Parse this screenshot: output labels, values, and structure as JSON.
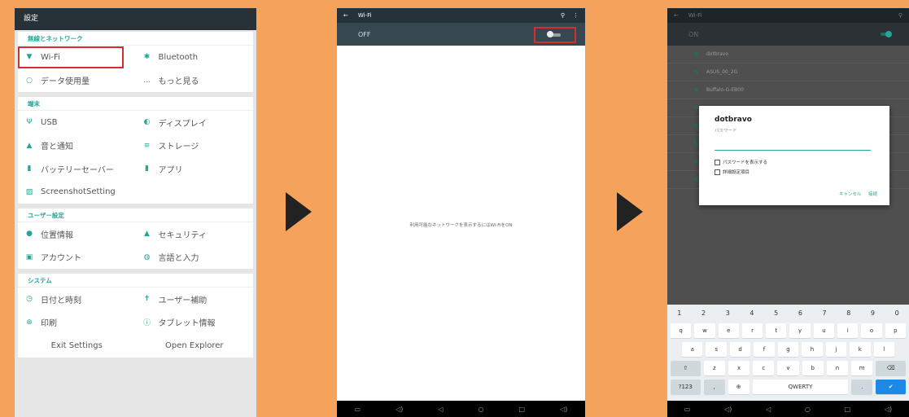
{
  "screen1": {
    "title": "設定",
    "sections": [
      {
        "title": "無線とネットワーク",
        "rows": [
          [
            {
              "icon": "▼",
              "label": "Wi-Fi"
            },
            {
              "icon": "✱",
              "label": "Bluetooth"
            }
          ],
          [
            {
              "icon": "○",
              "label": "データ使用量"
            },
            {
              "icon": "…",
              "label": "もっと見る"
            }
          ]
        ]
      },
      {
        "title": "端末",
        "rows": [
          [
            {
              "icon": "Ψ",
              "label": "USB"
            },
            {
              "icon": "◐",
              "label": "ディスプレイ"
            }
          ],
          [
            {
              "icon": "▲",
              "label": "音と通知"
            },
            {
              "icon": "≡",
              "label": "ストレージ"
            }
          ],
          [
            {
              "icon": "▮",
              "label": "バッテリーセーバー"
            },
            {
              "icon": "▮",
              "label": "アプリ"
            }
          ],
          [
            {
              "icon": "▨",
              "label": "ScreenshotSetting"
            },
            {
              "icon": "",
              "label": ""
            }
          ]
        ]
      },
      {
        "title": "ユーザー設定",
        "rows": [
          [
            {
              "icon": "●",
              "label": "位置情報"
            },
            {
              "icon": "▲",
              "label": "セキュリティ"
            }
          ],
          [
            {
              "icon": "▣",
              "label": "アカウント"
            },
            {
              "icon": "◍",
              "label": "言語と入力"
            }
          ]
        ]
      },
      {
        "title": "システム",
        "rows": [
          [
            {
              "icon": "◷",
              "label": "日付と時刻"
            },
            {
              "icon": "✝",
              "label": "ユーザー補助"
            }
          ],
          [
            {
              "icon": "⊕",
              "label": "印刷"
            },
            {
              "icon": "ⓘ",
              "label": "タブレット情報"
            }
          ],
          [
            {
              "icon": "",
              "label": "Exit Settings"
            },
            {
              "icon": "",
              "label": "Open Explorer"
            }
          ]
        ]
      }
    ]
  },
  "screen2": {
    "back": "←",
    "title": "Wi-Fi",
    "search": "⚲",
    "more": "⋮",
    "toggle_label": "OFF",
    "empty_message": "利用可能なネットワークを表示するにはWi-FiをON",
    "nav": [
      "▭",
      "◁)",
      "◁",
      "○",
      "□",
      "◁)"
    ]
  },
  "screen3": {
    "back": "←",
    "title": "Wi-Fi",
    "search": "⚲",
    "toggle_label": "ON",
    "networks": [
      "dotbravo",
      "ASUS_00_2G",
      "Buffalo-G-EB00",
      "",
      "",
      "",
      "",
      ""
    ],
    "dialog": {
      "ssid": "dotbravo",
      "password_label": "パスワード",
      "show_password": "パスワードを表示する",
      "advanced": "詳細設定項目",
      "cancel": "キャンセル",
      "connect": "接続"
    },
    "keyboard": {
      "numbers": [
        "1",
        "2",
        "3",
        "4",
        "5",
        "6",
        "7",
        "8",
        "9",
        "0"
      ],
      "row1": [
        "q",
        "w",
        "e",
        "r",
        "t",
        "y",
        "u",
        "i",
        "o",
        "p"
      ],
      "row2": [
        "a",
        "s",
        "d",
        "f",
        "g",
        "h",
        "j",
        "k",
        "l"
      ],
      "row3": [
        "⇧",
        "z",
        "x",
        "c",
        "v",
        "b",
        "n",
        "m",
        "⌫"
      ],
      "row4": [
        "?123",
        ",",
        "⊕",
        "QWERTY",
        ".",
        "✔"
      ]
    },
    "nav": [
      "▭",
      "◁)",
      "◁",
      "○",
      "□",
      "◁)"
    ]
  },
  "colors": {
    "background": "#F5A25A",
    "accent": "#26A69A",
    "highlight": "#D32F2F",
    "appbar": "#263238"
  }
}
